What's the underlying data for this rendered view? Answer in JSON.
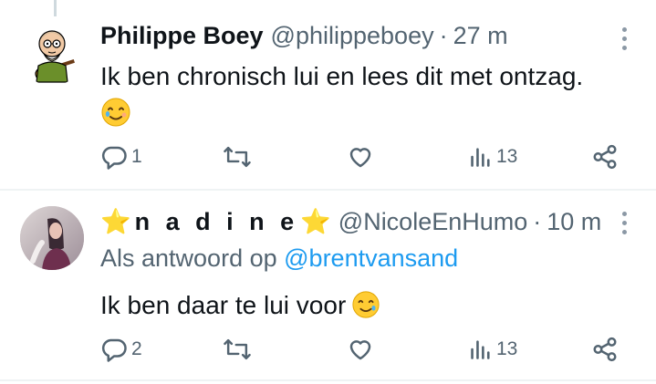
{
  "tweets": [
    {
      "display_name": "Philippe Boey",
      "handle": "@philippeboey",
      "separator": "·",
      "time": "27 m",
      "text": "Ik ben chronisch lui en lees dit met ontzag.",
      "emoji": "smiling-face-with-tear",
      "replies": "1",
      "views": "13"
    },
    {
      "display_name_prefix": "⭐",
      "display_name": "n a d i n e",
      "display_name_suffix": "⭐",
      "handle": "@NicoleEnHumo",
      "separator": "·",
      "time": "10 m",
      "reply_prefix": "Als antwoord op",
      "reply_mention": "@brentvansand",
      "text": "Ik ben daar te lui voor",
      "emoji": "smiling-face-with-tear",
      "replies": "2",
      "views": "13"
    }
  ],
  "colors": {
    "primary_text": "#0f1419",
    "secondary_text": "#536471",
    "link": "#1d9bf0",
    "divider": "#eff3f4"
  },
  "icons": [
    "reply-icon",
    "retweet-icon",
    "like-icon",
    "views-icon",
    "share-icon",
    "more-icon"
  ]
}
